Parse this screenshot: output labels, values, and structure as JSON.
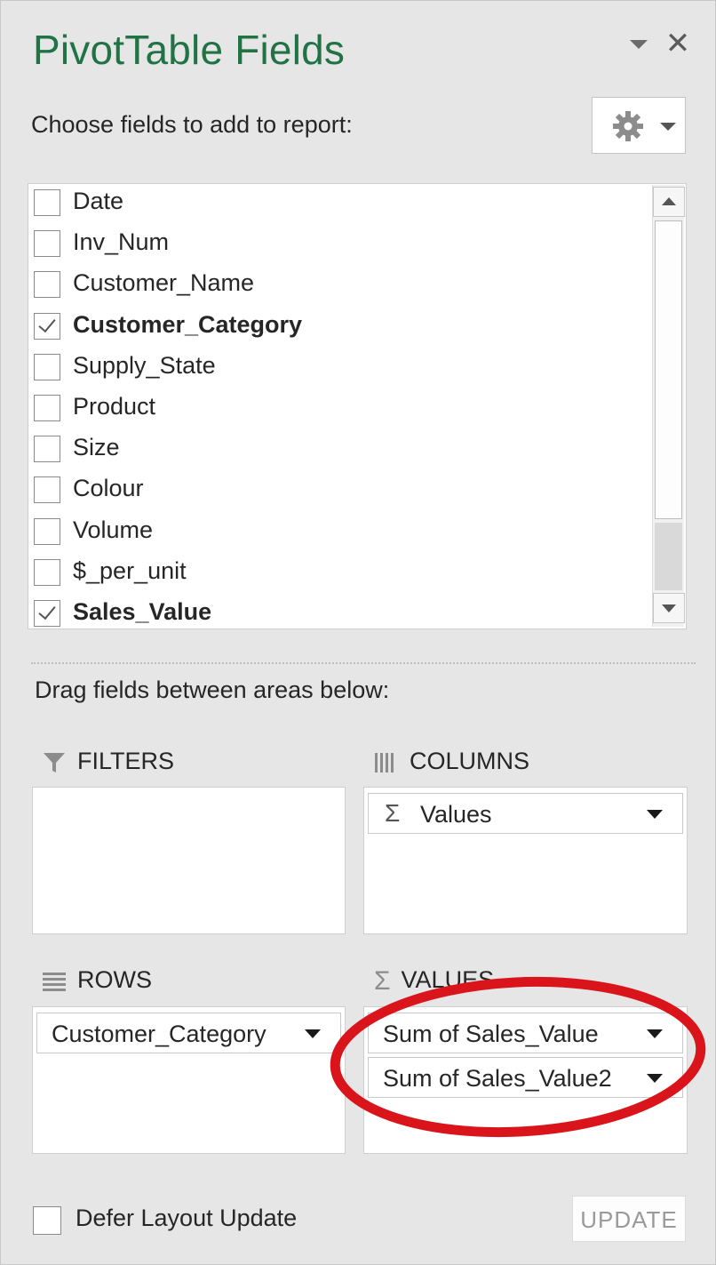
{
  "pane": {
    "title": "PivotTable Fields",
    "choose_label": "Choose fields to add to report:",
    "drag_label": "Drag fields between areas below:"
  },
  "fields": [
    {
      "label": "Date",
      "checked": false
    },
    {
      "label": "Inv_Num",
      "checked": false
    },
    {
      "label": "Customer_Name",
      "checked": false
    },
    {
      "label": "Customer_Category",
      "checked": true
    },
    {
      "label": "Supply_State",
      "checked": false
    },
    {
      "label": "Product",
      "checked": false
    },
    {
      "label": "Size",
      "checked": false
    },
    {
      "label": "Colour",
      "checked": false
    },
    {
      "label": "Volume",
      "checked": false
    },
    {
      "label": "$_per_unit",
      "checked": false
    },
    {
      "label": "Sales_Value",
      "checked": true
    }
  ],
  "areas": {
    "filters": {
      "label": "FILTERS",
      "items": []
    },
    "columns": {
      "label": "COLUMNS",
      "items": [
        "Values"
      ]
    },
    "rows": {
      "label": "ROWS",
      "items": [
        "Customer_Category"
      ]
    },
    "values": {
      "label": "VALUES",
      "items": [
        "Sum of Sales_Value",
        "Sum of Sales_Value2"
      ]
    }
  },
  "footer": {
    "defer_label": "Defer Layout Update",
    "defer_checked": false,
    "update_label": "UPDATE"
  },
  "colors": {
    "title": "#217346",
    "annotation": "#d9141b"
  },
  "icons": {
    "sigma": "Σ"
  }
}
